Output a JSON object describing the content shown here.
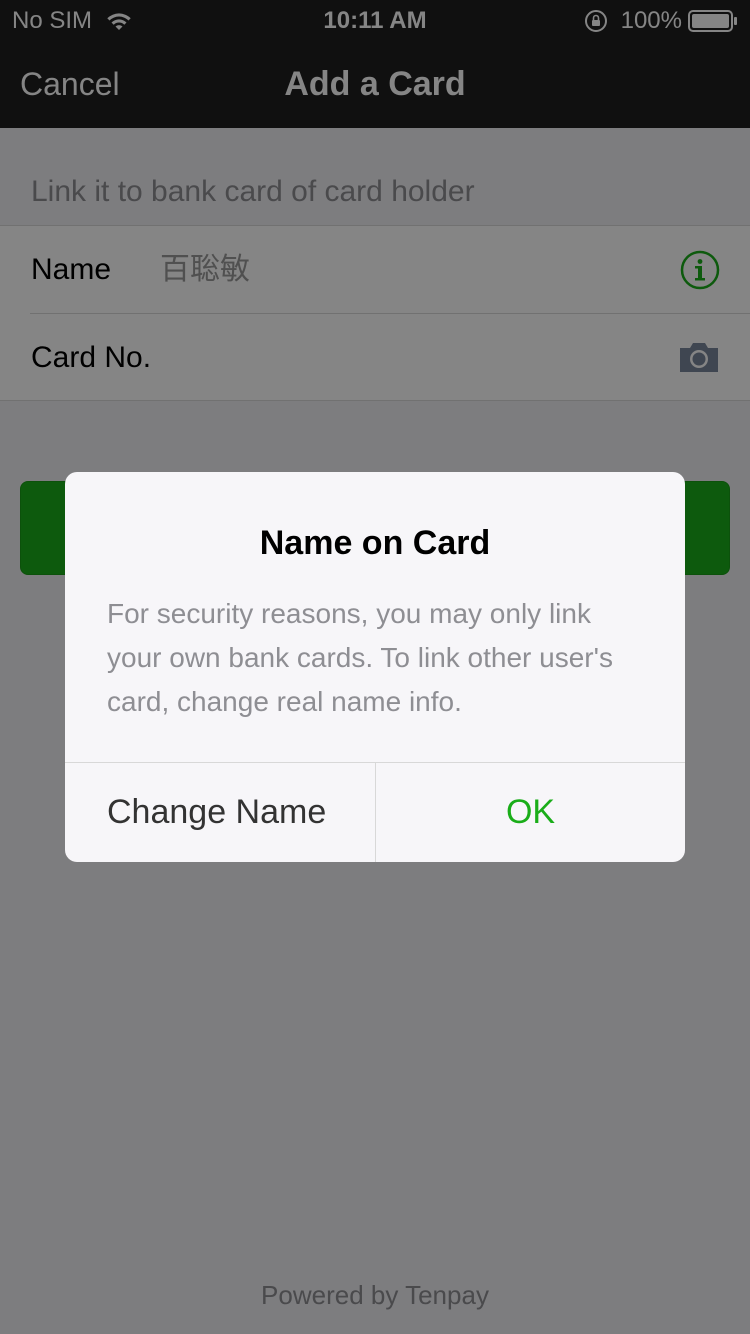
{
  "status_bar": {
    "carrier": "No SIM",
    "time": "10:11 AM",
    "battery": "100%"
  },
  "nav": {
    "cancel_label": "Cancel",
    "title": "Add a Card"
  },
  "form": {
    "section_header": "Link it to bank card of card holder",
    "name_label": "Name",
    "name_value": "百聡敏",
    "card_label": "Card No."
  },
  "footer": {
    "powered_by": "Powered by Tenpay"
  },
  "dialog": {
    "title": "Name on Card",
    "message": "For security reasons, you may only link your own bank cards. To link other user's card, change real name info.",
    "change_name_label": "Change Name",
    "ok_label": "OK"
  },
  "colors": {
    "accent_green": "#1aad19",
    "navbar_bg": "#1f1f1f"
  },
  "icons": [
    "wifi-icon",
    "orientation-lock-icon",
    "battery-icon",
    "info-icon",
    "camera-icon"
  ]
}
